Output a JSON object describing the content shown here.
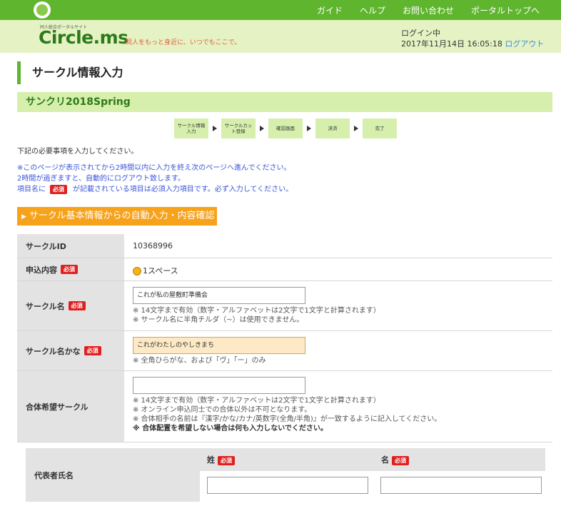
{
  "nav": {
    "items": [
      "ガイド",
      "ヘルプ",
      "お問い合わせ",
      "ポータルトップへ"
    ]
  },
  "header": {
    "brand": "Circle.ms",
    "brand_sub": "同人総合ポータルサイト",
    "tagline": "同人をもっと身近に、いつでもここで。",
    "login_state": "ログイン中",
    "login_time": "2017年11月14日 16:05:18",
    "logout": "ログアウト"
  },
  "page": {
    "title": "サークル情報入力",
    "event": "サンクリ2018Spring",
    "steps": [
      "サークル情報入力",
      "サークルカット登録",
      "確認画面",
      "決済",
      "完了"
    ],
    "intro": "下記の必要事項を入力してください。",
    "note1": "※このページが表示されてから2時間以内に入力を終え次のページへ進んでください。",
    "note2": "2時間が過ぎますと、自動的にログアウト致します。",
    "note3_pre": "項目名に",
    "note3_post": "が記載されている項目は必須入力項目です。必ず入力してください。",
    "required": "必須",
    "auto_button": "サークル基本情報からの自動入力・内容確認"
  },
  "form": {
    "circle_id": {
      "label": "サークルID",
      "value": "10368996"
    },
    "apply": {
      "label": "申込内容",
      "option": "1スペース"
    },
    "circle_name": {
      "label": "サークル名",
      "value": "これが私の屋敷町準備会",
      "hint1": "※ 14文字まで有効（数字・アルファベットは2文字で1文字と計算されます）",
      "hint2": "※ サークル名に半角チルダ（~）は使用できません。"
    },
    "circle_kana": {
      "label": "サークル名かな",
      "value": "これがわたしのやしきまち",
      "hint": "※ 全角ひらがな、および「ヴ」「ー」のみ"
    },
    "merge": {
      "label": "合体希望サークル",
      "value": "",
      "hint1": "※ 14文字まで有効（数字・アルファベットは2文字で1文字と計算されます）",
      "hint2": "※ オンライン申込同士での合体以外は不可となります。",
      "hint3": "※ 合体相手の名前は『漢字/かな/カナ/英数字(全角/半角)』が一致するように記入してください。",
      "hint4": "※ 合体配置を希望しない場合は何も入力しないでください。"
    },
    "rep": {
      "label": "代表者氏名",
      "sei": "姓",
      "mei": "名"
    }
  },
  "colors": {
    "nav": "#5fb52e",
    "header": "#e5f3c4",
    "accent": "#f7a21b",
    "required": "#e02020"
  }
}
